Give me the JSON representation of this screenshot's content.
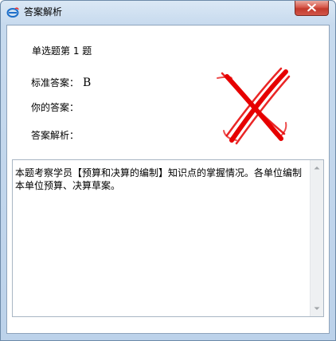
{
  "window": {
    "title": "答案解析"
  },
  "question": {
    "header": "单选题第 1 题"
  },
  "fields": {
    "standard_answer_label": "标准答案：",
    "standard_answer_value": "B",
    "your_answer_label": "你的答案：",
    "your_answer_value": "",
    "analysis_label": "答案解析："
  },
  "analysis": {
    "text": "本题考察学员【预算和决算的编制】知识点的掌握情况。各单位编制本单位预算、决算草案。"
  },
  "result": {
    "mark_icon": "wrong-x-icon",
    "mark_color": "#e60000"
  },
  "colors": {
    "titlebar_start": "#dbe8f5",
    "close_button": "#c23a2c"
  }
}
